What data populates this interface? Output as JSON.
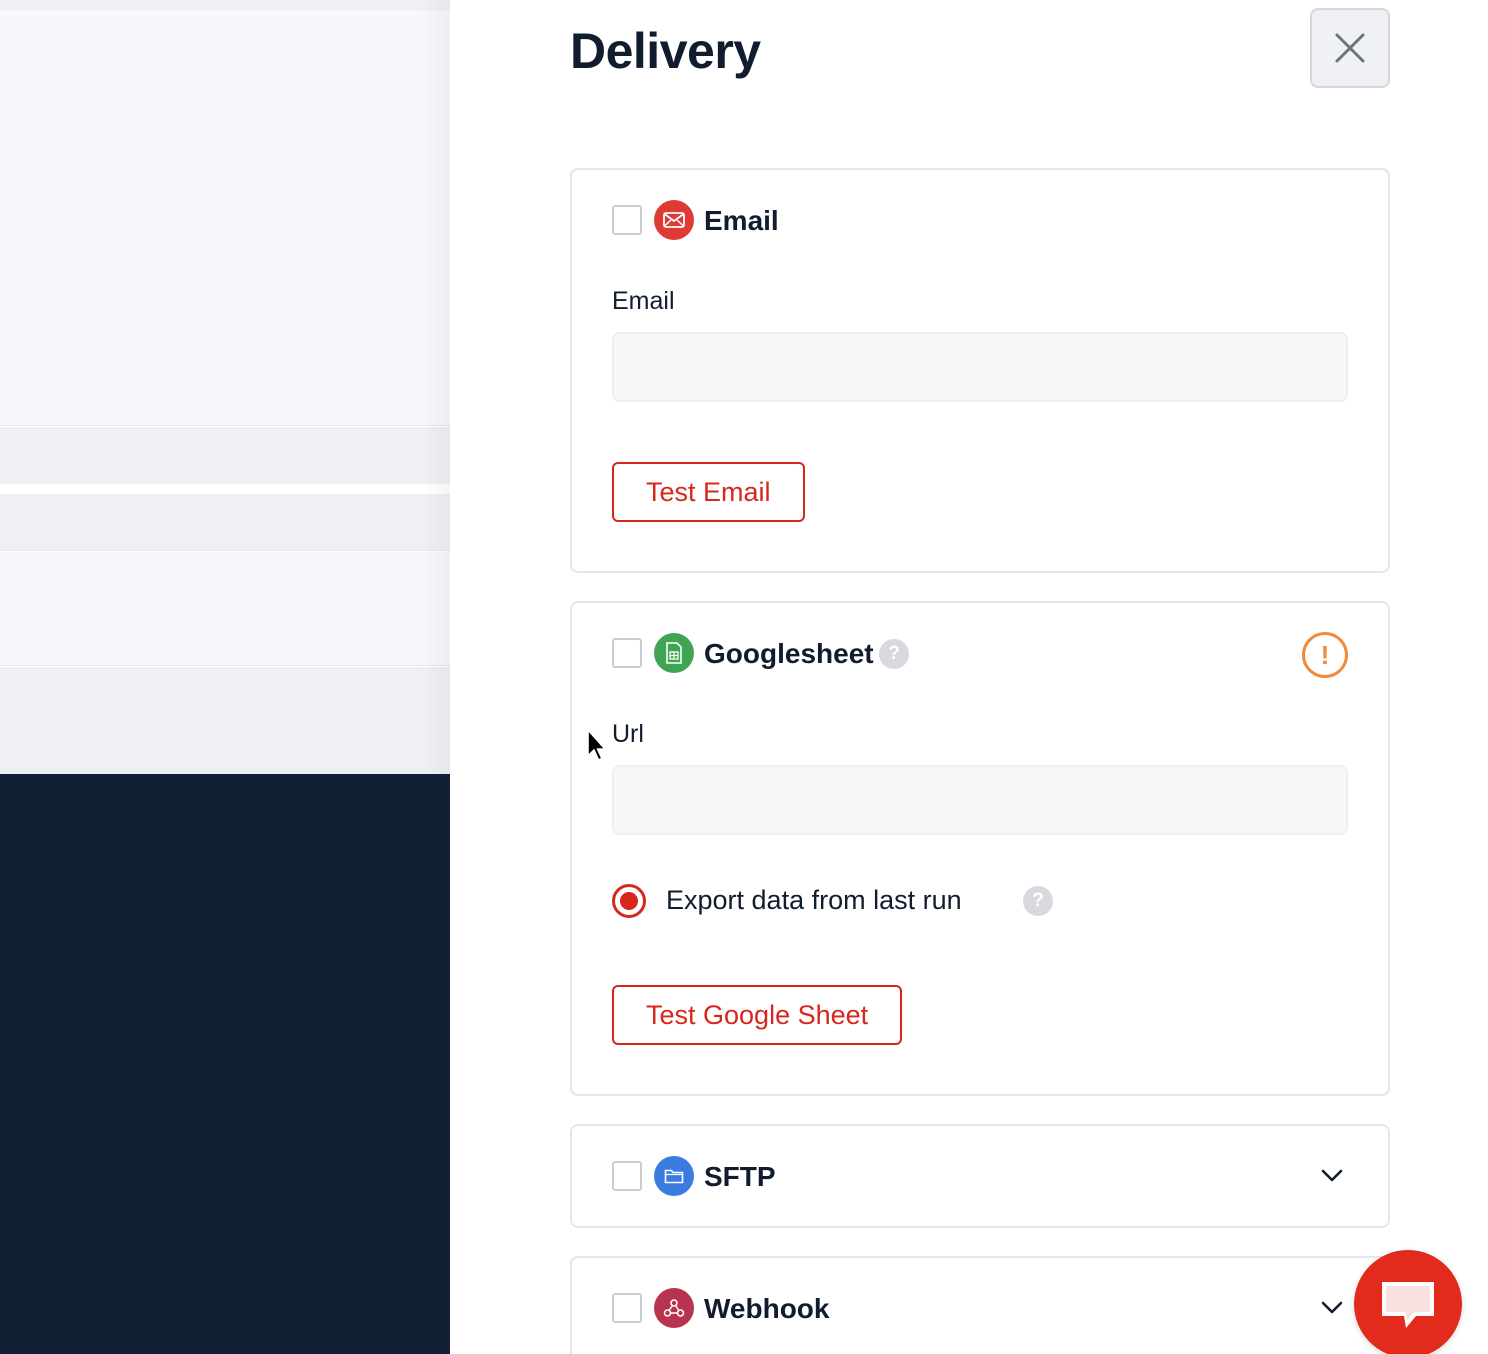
{
  "drawer": {
    "title": "Delivery",
    "close_icon": "close-icon"
  },
  "email_card": {
    "title": "Email",
    "icon": "envelope-icon",
    "icon_color": "#df3b34",
    "field_label": "Email",
    "field_value": "",
    "button_label": "Test Email"
  },
  "gsheet_card": {
    "title": "Googlesheet",
    "icon": "spreadsheet-icon",
    "icon_color": "#3fa553",
    "help_mark": "?",
    "warning_mark": "!",
    "field_label": "Url",
    "field_value": "",
    "radio_label": "Export data from last run",
    "radio_selected": true,
    "button_label": "Test Google Sheet"
  },
  "sftp_card": {
    "title": "SFTP",
    "icon": "folder-icon",
    "icon_color": "#3b7be0"
  },
  "webhook_card": {
    "title": "Webhook",
    "icon": "webhook-icon",
    "icon_color": "#b8334e"
  },
  "colors": {
    "accent": "#d9261c",
    "warning": "#f08a3c",
    "dark_panel": "#122036",
    "chat_fab": "#e22b1c"
  }
}
